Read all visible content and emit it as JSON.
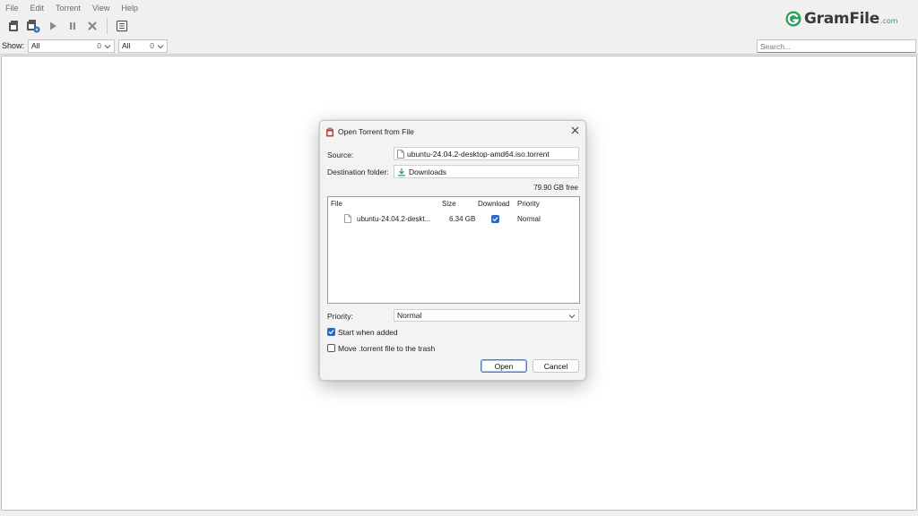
{
  "menu": [
    "File",
    "Edit",
    "Torrent",
    "View",
    "Help"
  ],
  "logo": {
    "name": "GramFile",
    "suffix": ".com",
    "brand_color": "#2e9e5b"
  },
  "filter": {
    "show_label": "Show:",
    "filter1": {
      "value": "All",
      "count": "0"
    },
    "filter2": {
      "value": "All",
      "count": "0"
    },
    "search_placeholder": "Search..."
  },
  "toolbar_icons": [
    "open-torrent-icon",
    "open-url-icon",
    "start-icon",
    "pause-icon",
    "remove-icon",
    "properties-icon"
  ],
  "dialog": {
    "title": "Open Torrent from File",
    "source_label": "Source:",
    "source_value": "ubuntu-24.04.2-desktop-amd64.iso.torrent",
    "dest_label": "Destination folder:",
    "dest_value": "Downloads",
    "free_space": "79.90 GB free",
    "columns": {
      "file": "File",
      "size": "Size",
      "download": "Download",
      "priority": "Priority"
    },
    "files": [
      {
        "name": "ubuntu-24.04.2-deskt...",
        "size": "6.34 GB",
        "download": true,
        "priority": "Normal"
      }
    ],
    "priority_label": "Priority:",
    "priority_value": "Normal",
    "start_when_added": {
      "label": "Start when added",
      "checked": true
    },
    "move_to_trash": {
      "label": "Move .torrent file to the trash",
      "checked": false
    },
    "open_button": "Open",
    "cancel_button": "Cancel",
    "accent_color": "#2a6ac4"
  }
}
